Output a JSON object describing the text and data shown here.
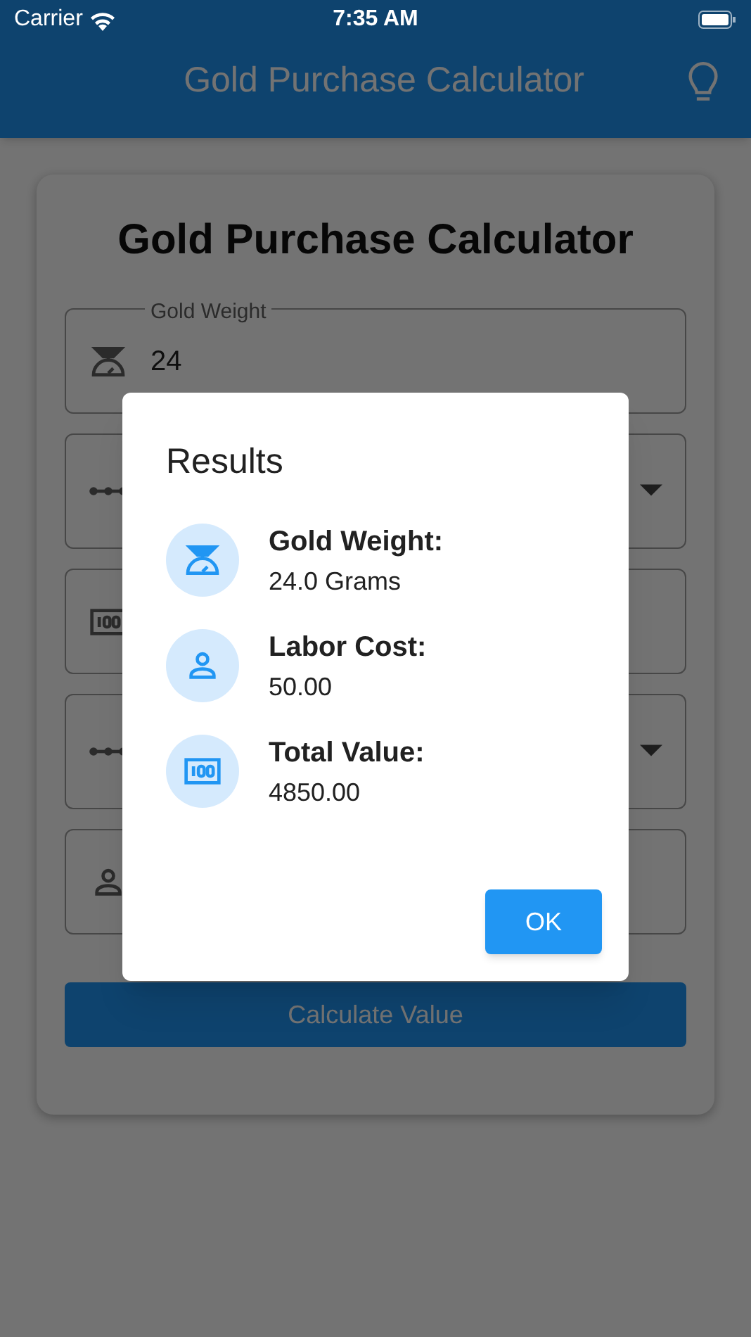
{
  "status_bar": {
    "carrier": "Carrier",
    "time": "7:35 AM"
  },
  "app_bar": {
    "title": "Gold Purchase Calculator"
  },
  "card": {
    "title": "Gold Purchase Calculator",
    "fields": [
      {
        "kind": "text",
        "label": "Gold Weight",
        "value": "24"
      },
      {
        "kind": "dropdown"
      },
      {
        "kind": "text"
      },
      {
        "kind": "dropdown"
      },
      {
        "kind": "text"
      }
    ],
    "button": "Calculate Value"
  },
  "dialog": {
    "title": "Results",
    "results": [
      {
        "label": "Gold Weight:",
        "value": "24.0 Grams"
      },
      {
        "label": "Labor Cost:",
        "value": "50.00"
      },
      {
        "label": "Total Value:",
        "value": "4850.00"
      }
    ],
    "button": "OK"
  }
}
